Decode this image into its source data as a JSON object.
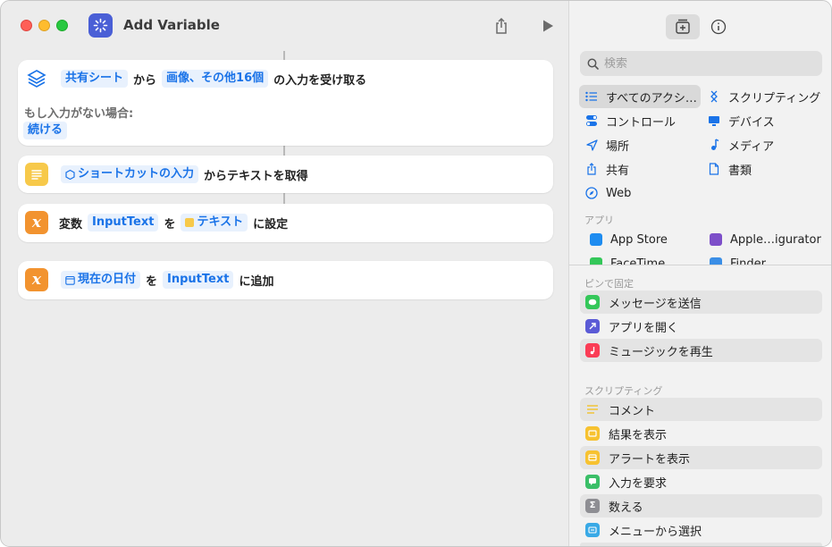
{
  "window": {
    "title": "Add Variable"
  },
  "actions": [
    {
      "t1": "共有シート",
      "w1": "から",
      "t2": "画像、その他16個",
      "w2": "の入力を受け取る",
      "sub_label": "もし入力がない場合:",
      "sub_token": "続ける"
    },
    {
      "t1": "ショートカットの入力",
      "w1": "からテキストを取得"
    },
    {
      "w0": "変数",
      "t1": "InputText",
      "w1": "を",
      "t2": "テキスト",
      "w2": "に設定"
    },
    {
      "t1": "現在の日付",
      "w1": "を",
      "t2": "InputText",
      "w2": "に追加"
    }
  ],
  "sidebar": {
    "search_placeholder": "検索",
    "categories_left": [
      "すべてのアクシ…",
      "コントロール",
      "場所",
      "共有",
      "Web"
    ],
    "categories_right": [
      "スクリプティング",
      "デバイス",
      "メディア",
      "書類"
    ],
    "apps_header": "アプリ",
    "apps": [
      "App Store",
      "Apple…igurator",
      "FaceTime",
      "Finder"
    ],
    "pinned_header": "ピンで固定",
    "pinned": [
      "メッセージを送信",
      "アプリを開く",
      "ミュージックを再生"
    ],
    "scripting_header": "スクリプティング",
    "scripting": [
      "コメント",
      "結果を表示",
      "アラートを表示",
      "入力を要求",
      "数える",
      "メニューから選択"
    ]
  },
  "colors": {
    "accent": "#1a73e8",
    "app_icon": "#4a5fd6",
    "variable_orange": "#f2932f",
    "text_yellow": "#f7c94a"
  }
}
